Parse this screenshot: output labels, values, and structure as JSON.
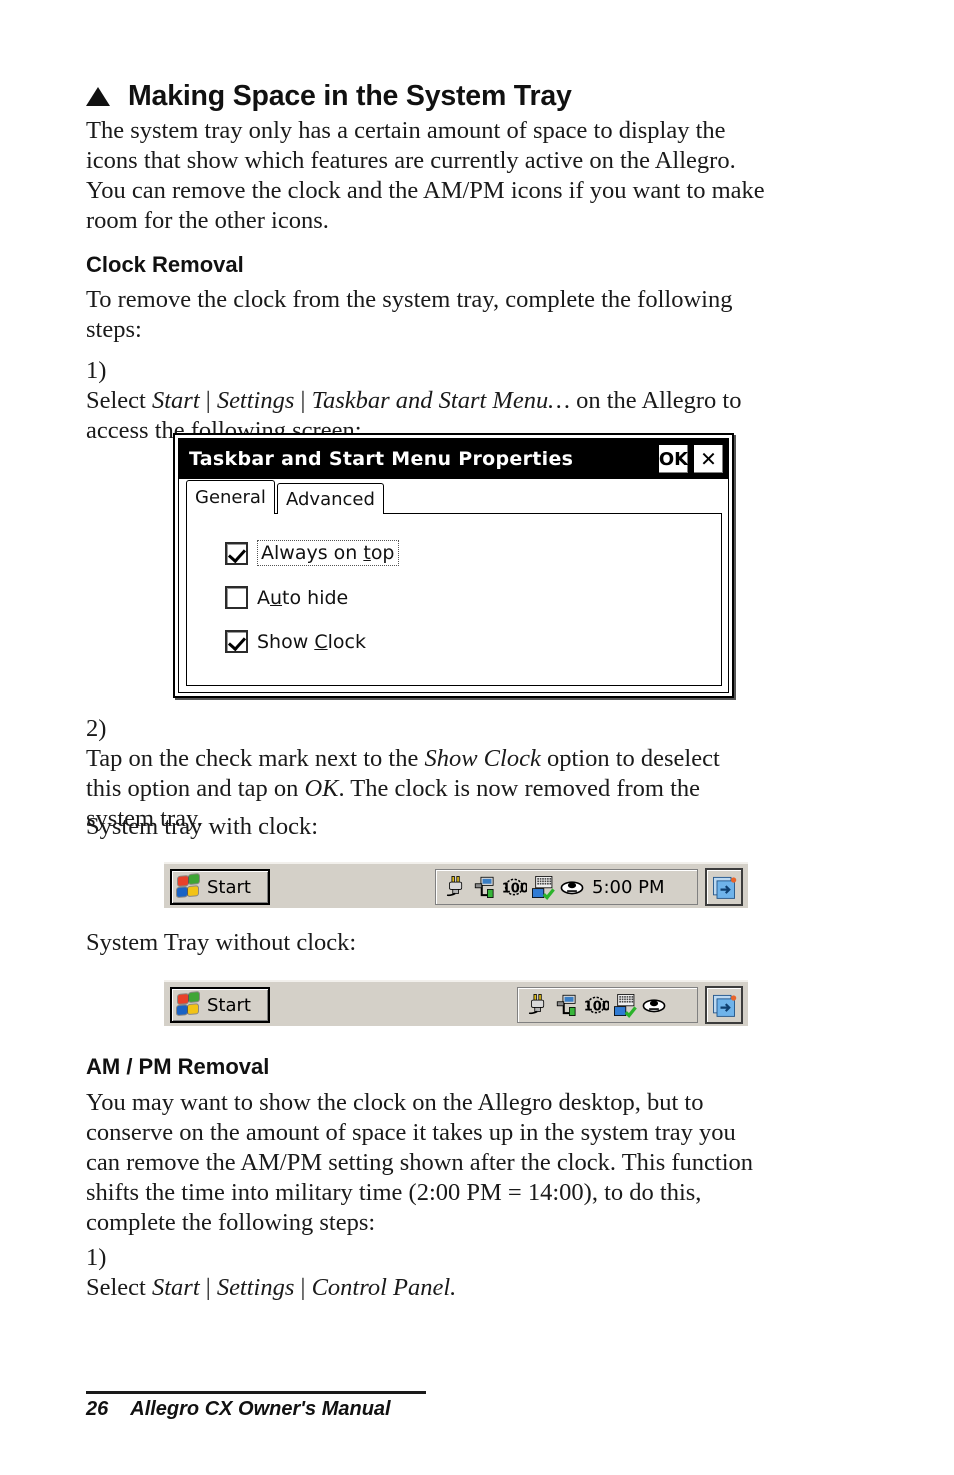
{
  "page": {
    "number": "26",
    "footer_title": "Allegro CX Owner's Manual"
  },
  "headings": {
    "main": "Making Space in the System Tray",
    "bullet_marker": "triangle",
    "clock_removal": "Clock Removal",
    "ampm_removal": "AM / PM Removal"
  },
  "intro": {
    "lines": [
      "The system tray only has a certain amount of space to display the",
      "icons that show which features are currently active on the Allegro.",
      "You can remove the clock and the AM/PM icons if you want to make",
      "room for the other icons."
    ]
  },
  "clock_removal": {
    "intro_lines": [
      "To remove the clock from the system tray, complete the following",
      "steps:"
    ],
    "step1": {
      "num": "1)",
      "pre": "Select ",
      "path1": "Start",
      "sep1": " | ",
      "path2": "Settings",
      "sep2": " | ",
      "path3": "Taskbar and Start Menu…",
      "post": " on the Allegro to",
      "line2": "access the following screen:"
    },
    "step2": {
      "num": "2)",
      "l1_pre": "Tap on the check mark next to the ",
      "l1_em": "Show Clock",
      "l1_post": " option to deselect",
      "l2_pre": "this option and tap on ",
      "l2_em": "OK",
      "l2_post": ". The clock is now removed from the",
      "l3": "system tray."
    },
    "caption_with_clock": "System tray with clock:",
    "caption_without_clock": "System Tray without clock:"
  },
  "dialog": {
    "title": "Taskbar and Start Menu Properties",
    "ok_label": "OK",
    "close_label": "✕",
    "tabs": [
      {
        "label": "General",
        "active": true
      },
      {
        "label": "Advanced",
        "active": false
      }
    ],
    "checkboxes": [
      {
        "label_pre": "Always on ",
        "accel": "t",
        "label_post": "op",
        "checked": true,
        "focused": true
      },
      {
        "label_pre": "A",
        "accel": "u",
        "label_post": "to hide",
        "checked": false,
        "focused": false
      },
      {
        "label_pre": "Show ",
        "accel": "C",
        "label_post": "lock",
        "checked": true,
        "focused": false
      }
    ]
  },
  "taskbar_with_clock": {
    "start_label": "Start",
    "tray_icons": [
      "ac-power-plug-icon",
      "network-connection-icon",
      "battery-100-icon",
      "keyboard-sip-icon",
      "display-brightness-icon"
    ],
    "clock": "5:00 PM",
    "show_clock": true,
    "desktop_button_icon": "show-desktop-icon"
  },
  "taskbar_without_clock": {
    "start_label": "Start",
    "tray_icons": [
      "ac-power-plug-icon",
      "network-connection-icon",
      "battery-100-icon",
      "keyboard-sip-icon",
      "display-brightness-icon"
    ],
    "clock": "",
    "show_clock": false,
    "desktop_button_icon": "show-desktop-icon"
  },
  "ampm_removal": {
    "lines": [
      "You may want to show the clock on the Allegro desktop, but to",
      "conserve on the amount of space it takes up in the system tray you",
      "can remove the AM/PM setting shown after the clock. This function",
      "shifts the time into military time (2:00 PM = 14:00), to do this,",
      "complete the following steps:"
    ],
    "step1": {
      "num": "1)",
      "pre": "Select ",
      "path1": "Start",
      "sep1": " | ",
      "path2": "Settings",
      "sep2": " | ",
      "path3": "Control Panel."
    }
  },
  "colors": {
    "ink": "#1a1a1a",
    "titlebar_bg": "#000000",
    "taskbar_bg": "#d4d0c8"
  }
}
